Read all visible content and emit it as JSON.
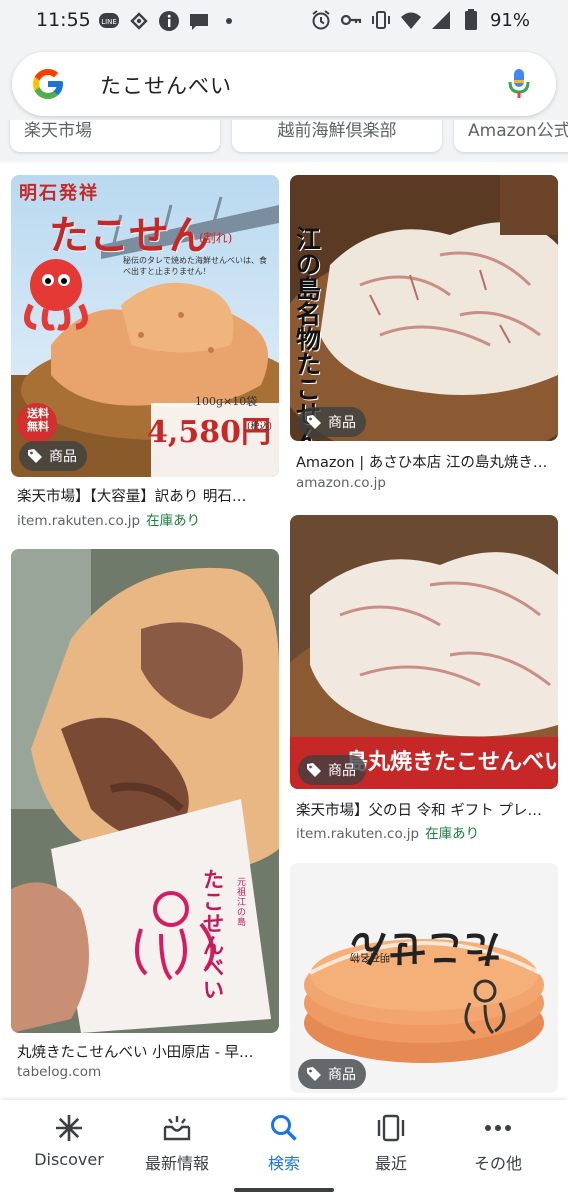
{
  "status_bar": {
    "time": "11:55",
    "battery": "91%",
    "left_icons": [
      "line-icon",
      "voice-icon",
      "info-icon",
      "chat-icon",
      "dot-icon"
    ],
    "right_icons": [
      "alarm-icon",
      "key-icon",
      "vibrate-icon",
      "wifi-icon",
      "signal-icon",
      "battery-icon"
    ]
  },
  "search": {
    "query": "たこせんべい"
  },
  "chips": [
    "楽天市場",
    "越前海鮮倶楽部",
    "Amazon公式"
  ],
  "results": [
    {
      "title": "楽天市場】【大容量】訳あり 明石…",
      "source": "item.rakuten.co.jp",
      "stock": "在庫あり",
      "badge": "商品",
      "image_texts": {
        "brand": "明石発祥",
        "big": "たこせん",
        "sub": "(割れ)",
        "tag1": "送料",
        "tag2": "無料",
        "qty": "100g×10袋",
        "price": "4,580円",
        "tax": "(税込)",
        "note": "秘伝のタレで焼めた海鮮せんべいは、食べ出すと止まりません！"
      }
    },
    {
      "title": "Amazon | あさひ本店 江の島丸焼き…",
      "source": "amazon.co.jp",
      "badge": "商品",
      "image_texts": {
        "vertical": "江の島名物たこせん"
      }
    },
    {
      "title": "丸焼きたこせんべい 小田原店 - 早…",
      "source": "tabelog.com",
      "image_texts": {
        "bag": "たこせんべい",
        "bag_small": "元祖 江の島"
      }
    },
    {
      "title": "楽天市場】父の日 令和 ギフト プレ…",
      "source": "item.rakuten.co.jp",
      "stock": "在庫あり",
      "badge": "商品",
      "image_texts": {
        "banner": "島丸焼きたこせんべい"
      }
    },
    {
      "title": "",
      "source": "",
      "badge": "商品",
      "image_texts": {
        "pack": "たこせん",
        "pack_small": "明石名物"
      }
    }
  ],
  "bottom_nav": {
    "items": [
      {
        "label": "Discover",
        "icon": "asterisk-icon"
      },
      {
        "label": "最新情報",
        "icon": "updates-icon"
      },
      {
        "label": "検索",
        "icon": "search-icon",
        "active": true
      },
      {
        "label": "最近",
        "icon": "recent-icon"
      },
      {
        "label": "その他",
        "icon": "more-icon"
      }
    ]
  },
  "colors": {
    "accent": "#1a73e8",
    "in_stock": "#188038",
    "background": "#f1f3f4"
  }
}
